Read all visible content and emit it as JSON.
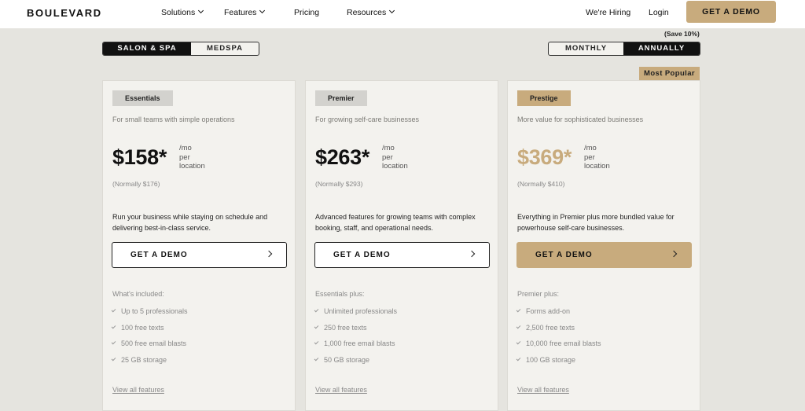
{
  "nav": {
    "logo": "BOULEVARD",
    "solutions": "Solutions",
    "features": "Features",
    "pricing": "Pricing",
    "resources": "Resources",
    "hiring": "We're Hiring",
    "login": "Login",
    "demo": "GET A DEMO"
  },
  "segment": {
    "salon": "SALON & SPA",
    "medspa": "MEDSPA",
    "selected": "SALON & SPA"
  },
  "billing": {
    "monthly": "MONTHLY",
    "annually": "ANNUALLY",
    "selected": "ANNUALLY",
    "save": "(Save 10%)"
  },
  "popular": "Most Popular",
  "colors": {
    "accent": "#c8ab7d",
    "dark": "#111111",
    "page_bg": "#e5e4df",
    "card_bg": "#f3f2ee"
  },
  "plans": [
    {
      "name": "Essentials",
      "subtitle": "For small teams with simple operations",
      "price": "$158*",
      "unit": [
        "/mo",
        "per",
        "location"
      ],
      "normally": "(Normally $176)",
      "desc": "Run your business while staying on schedule and delivering best-in-class service.",
      "cta": "GET A DEMO",
      "includes": "What's included:",
      "features": [
        "Up to 5 professionals",
        "100 free texts",
        "500 free email blasts",
        "25 GB storage"
      ],
      "view": "View all features"
    },
    {
      "name": "Premier",
      "subtitle": "For growing self-care businesses",
      "price": "$263*",
      "unit": [
        "/mo",
        "per",
        "location"
      ],
      "normally": "(Normally $293)",
      "desc": "Advanced features for growing teams with complex booking, staff, and operational needs.",
      "cta": "GET A DEMO",
      "includes": "Essentials plus:",
      "features": [
        "Unlimited professionals",
        "250 free texts",
        "1,000 free email blasts",
        "50 GB storage"
      ],
      "view": "View all features"
    },
    {
      "name": "Prestige",
      "subtitle": "More value for sophisticated businesses",
      "price": "$369*",
      "unit": [
        "/mo",
        "per",
        "location"
      ],
      "normally": "(Normally $410)",
      "desc": "Everything in Premier plus more bundled value for powerhouse self-care businesses.",
      "cta": "GET A DEMO",
      "includes": "Premier plus:",
      "features": [
        "Forms add-on",
        "2,500 free texts",
        "10,000 free email blasts",
        "100 GB storage"
      ],
      "view": "View all features"
    }
  ]
}
